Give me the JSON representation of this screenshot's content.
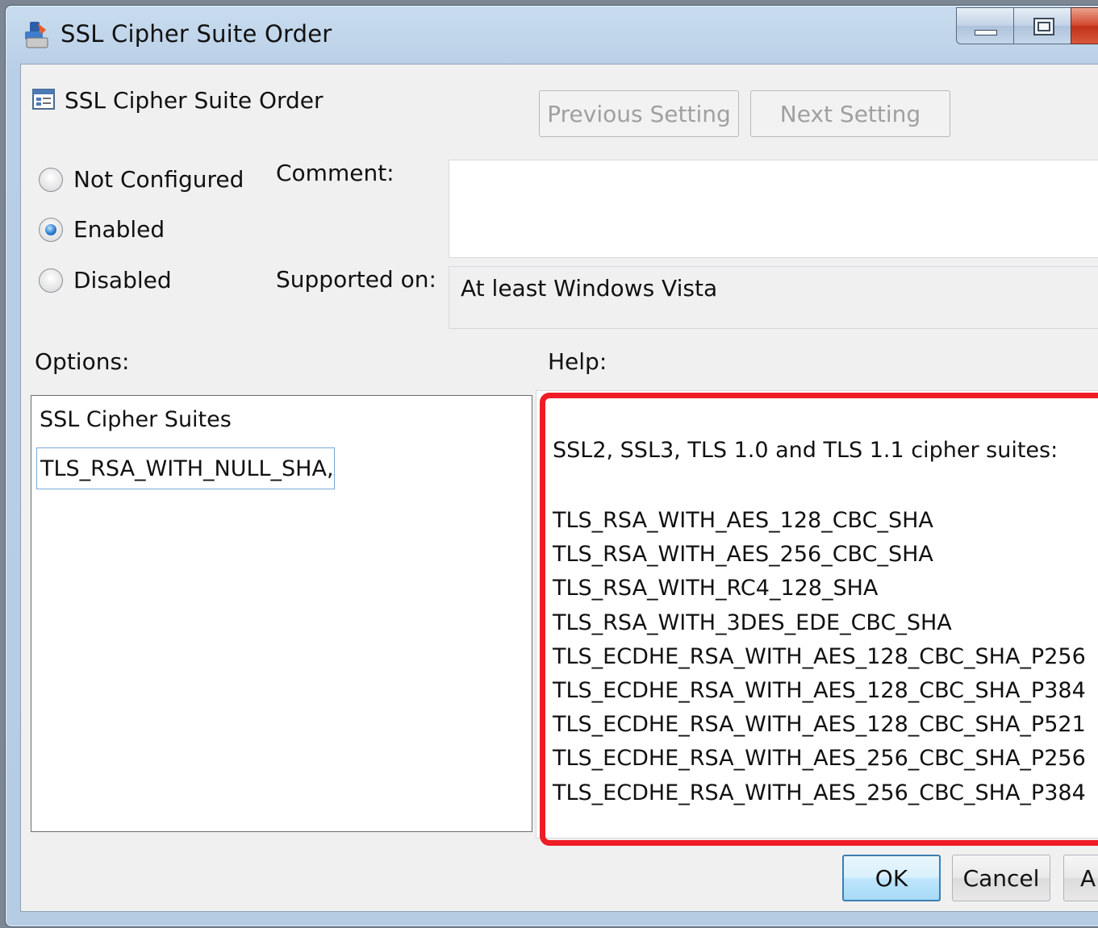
{
  "window": {
    "title": "SSL Cipher Suite Order",
    "icon": "policy-settings-icon"
  },
  "header": {
    "title": "SSL Cipher Suite Order",
    "icon": "policy-setting-icon",
    "prev_label": "Previous Setting",
    "next_label": "Next Setting"
  },
  "state": {
    "options": [
      {
        "label": "Not Configured",
        "checked": false
      },
      {
        "label": "Enabled",
        "checked": true
      },
      {
        "label": "Disabled",
        "checked": false
      }
    ]
  },
  "comment": {
    "label": "Comment:",
    "value": ""
  },
  "supported": {
    "label": "Supported on:",
    "value": "At least Windows Vista"
  },
  "options_panel": {
    "label": "Options:",
    "field_label": "SSL Cipher Suites",
    "field_value": ",TLS_RSA_WITH_NULL_SHA"
  },
  "help": {
    "label": "Help:",
    "highlight_color": "#ee1c25",
    "intro": "SSL2, SSL3, TLS 1.0 and TLS 1.1 cipher suites:",
    "suites": [
      "TLS_RSA_WITH_AES_128_CBC_SHA",
      "TLS_RSA_WITH_AES_256_CBC_SHA",
      "TLS_RSA_WITH_RC4_128_SHA",
      "TLS_RSA_WITH_3DES_EDE_CBC_SHA",
      "TLS_ECDHE_RSA_WITH_AES_128_CBC_SHA_P256",
      "TLS_ECDHE_RSA_WITH_AES_128_CBC_SHA_P384",
      "TLS_ECDHE_RSA_WITH_AES_128_CBC_SHA_P521",
      "TLS_ECDHE_RSA_WITH_AES_256_CBC_SHA_P256",
      "TLS_ECDHE_RSA_WITH_AES_256_CBC_SHA_P384"
    ]
  },
  "footer": {
    "ok_label": "OK",
    "cancel_label": "Cancel",
    "apply_label": "A"
  }
}
